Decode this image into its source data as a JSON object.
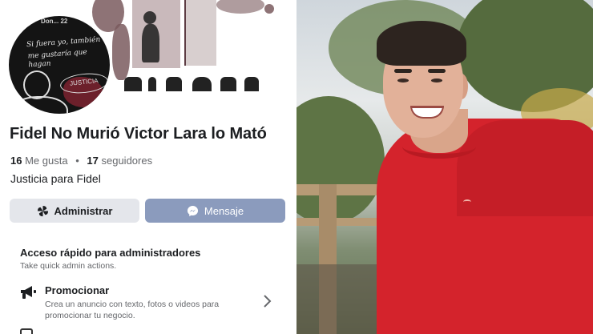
{
  "cover": {
    "avatar_small_text": "Don...  22",
    "avatar_handwriting": [
      "Si fuera yo, también",
      "me gustaría que hagan"
    ],
    "avatar_stamp_text": "JUSTICIA"
  },
  "page": {
    "name": "Fidel No Murió Victor Lara lo Mató",
    "likes_count": "16",
    "likes_label": "Me gusta",
    "followers_count": "17",
    "followers_label": "seguidores",
    "bio": "Justicia para Fidel"
  },
  "actions": {
    "admin_label": "Administrar",
    "message_label": "Mensaje"
  },
  "quick_access": {
    "title": "Acceso rápido para administradores",
    "subtitle": "Take quick admin actions.",
    "items": [
      {
        "title": "Promocionar",
        "description": "Crea un anuncio con texto, fotos o videos para promocionar tu negocio.",
        "icon": "megaphone-icon"
      }
    ]
  },
  "colors": {
    "message_button": "#8b9bbd",
    "admin_button": "#e4e6eb",
    "shirt": "#d4232c"
  }
}
